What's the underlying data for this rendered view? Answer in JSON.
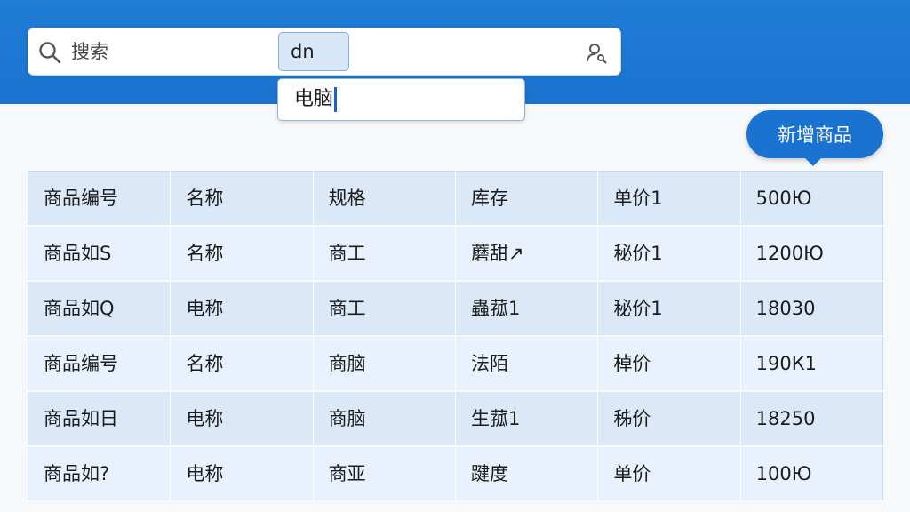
{
  "search": {
    "placeholder": "搜索",
    "ime_composition": "dn",
    "suggestion": "电脑"
  },
  "toolbar": {
    "add_label": "新增商品"
  },
  "icons": {
    "search": "search-icon",
    "voice": "voice-search-icon"
  },
  "colors": {
    "header": "#1a73cf",
    "accent": "#1b73d1",
    "row_odd": "#dae8f7",
    "row_even": "#e9f2fc"
  },
  "table": {
    "rows": [
      [
        "商品编号",
        "名称",
        "规格",
        "库存",
        "单价1",
        "500Ю"
      ],
      [
        "商品如S",
        "名称",
        "商工",
        "蘑甜↗",
        "秘价1",
        "1200Ю"
      ],
      [
        "商品如Q",
        "电称",
        "商工",
        "蟲菰1",
        "秘价1",
        "18030"
      ],
      [
        "商品编号",
        "名称",
        "商脑",
        "法陌",
        "棹价",
        "190К1"
      ],
      [
        "商品如日",
        "电称",
        "商脑",
        "生菰1",
        "秭价",
        "18250"
      ],
      [
        "商品如?",
        "电称",
        "商亚",
        "踺度",
        "单价",
        "100Ю"
      ]
    ]
  }
}
